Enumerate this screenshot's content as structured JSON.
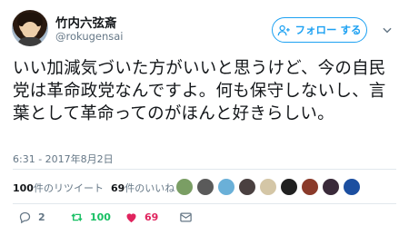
{
  "user": {
    "display_name": "竹内六弦斎",
    "handle": "@rokugensai"
  },
  "follow_button": {
    "label": "フォロー する"
  },
  "tweet": {
    "text": "いい加減気づいた方がいいと思うけど、今の自民党は革命政党なんですよ。何も保守しないし、言葉として革命ってのがほんと好きらしい。",
    "timestamp": "6:31 - 2017年8月2日"
  },
  "stats": {
    "retweets_count": "100",
    "retweets_label": "件のリツイート",
    "likes_count": "69",
    "likes_label": "件のいいね"
  },
  "liker_avatars": [
    {
      "name": "liker-1",
      "color": "#7a9e64"
    },
    {
      "name": "liker-2",
      "color": "#5a5a5a"
    },
    {
      "name": "liker-3",
      "color": "#6ab0d8"
    },
    {
      "name": "liker-4",
      "color": "#4a4040"
    },
    {
      "name": "liker-5",
      "color": "#d4c6a6"
    },
    {
      "name": "liker-6",
      "color": "#202020"
    },
    {
      "name": "liker-7",
      "color": "#8a3a2a"
    },
    {
      "name": "liker-8",
      "color": "#3a2a3a"
    },
    {
      "name": "liker-9",
      "color": "#1c4fa0"
    }
  ],
  "actions": {
    "reply_count": "2",
    "retweet_count": "100",
    "like_count": "69"
  },
  "colors": {
    "accent": "#1da1f2",
    "retweet": "#17bf63",
    "like": "#e0245e",
    "muted": "#657786"
  }
}
